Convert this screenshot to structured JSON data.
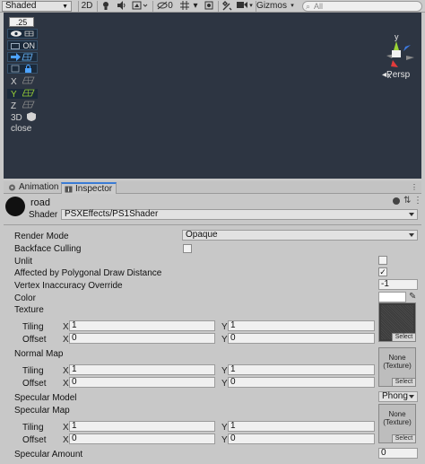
{
  "scene_toolbar": {
    "shading": "Shaded",
    "mode_2d": "2D",
    "hidden_count": "0",
    "gizmos": "Gizmos",
    "search_placeholder": "All"
  },
  "scene_overlay": {
    "value_box": ".25",
    "on_label": "ON",
    "axis_x": "X",
    "axis_y": "Y",
    "axis_z": "Z",
    "label_3d": "3D",
    "close": "close"
  },
  "gizmo": {
    "y": "y",
    "x": "x",
    "persp": "Persp"
  },
  "tabs": [
    {
      "label": "Animation"
    },
    {
      "label": "Inspector"
    }
  ],
  "material": {
    "name": "road",
    "shader_label": "Shader",
    "shader_value": "PSXEffects/PS1Shader"
  },
  "properties": {
    "render_mode_label": "Render Mode",
    "render_mode_value": "Opaque",
    "backface_label": "Backface Culling",
    "unlit_label": "Unlit",
    "affected_label": "Affected by Polygonal Draw Distance",
    "affected_checked": true,
    "vertex_label": "Vertex Inaccuracy Override",
    "vertex_value": "-1",
    "color_label": "Color",
    "texture_label": "Texture",
    "normal_map_label": "Normal Map",
    "specular_model_label": "Specular Model",
    "specular_model_value": "Phong",
    "specular_map_label": "Specular Map",
    "specular_amount_label": "Specular Amount",
    "specular_amount_value": "0"
  },
  "texture_block": {
    "tiling_label": "Tiling",
    "offset_label": "Offset",
    "x_axis": "X",
    "y_axis": "Y",
    "tiling_x": "1",
    "tiling_y": "1",
    "offset_x": "0",
    "offset_y": "0",
    "select": "Select",
    "none_texture": "None\n(Texture)"
  },
  "colors": {
    "scene_bg": "#2d3542",
    "tab_accent": "#3a7bd5",
    "gizmo_y": "#9bd336",
    "gizmo_x": "#e23b3b",
    "gizmo_z": "#3d7ae0"
  }
}
